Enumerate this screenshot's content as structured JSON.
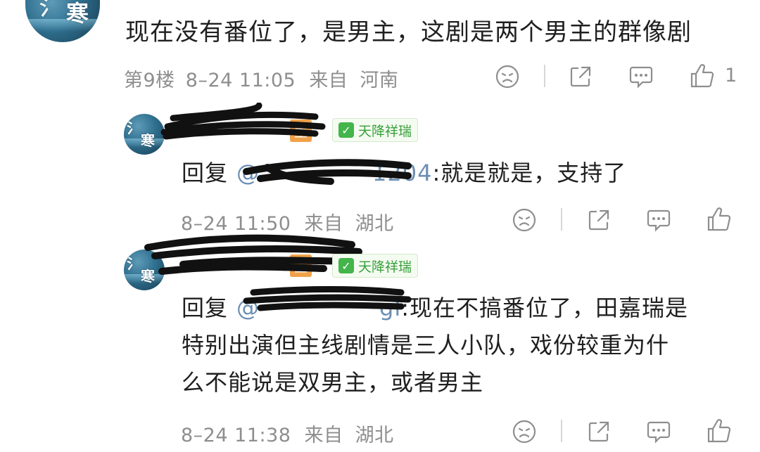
{
  "comment": {
    "text": "现在没有番位了，是男主，这剧是两个男主的群像剧",
    "floor": "第9楼",
    "time": "8–24 11:05",
    "from": "来自",
    "location": "河南",
    "like_count": "1",
    "avatar_glyph": "寒"
  },
  "replies": [
    {
      "avatar_glyph": "寒",
      "badge_orange": "主",
      "badge_green": "天降祥瑞",
      "reply_prefix": "回复",
      "mention": "@",
      "mention_tail": "1204",
      "text": ":就是就是，支持了",
      "time": "8–24 11:50",
      "from": "来自",
      "location": "湖北"
    },
    {
      "avatar_glyph": "寒",
      "badge_orange": "主",
      "badge_green": "天降祥瑞",
      "reply_prefix": "回复",
      "mention": "@",
      "mention_tail": "gl",
      "text_line1": ":现在不搞番位了，田嘉瑞是",
      "text_line2": "特别出演但主线剧情是三人小队，戏份较重为什",
      "text_line3": "么不能说是双男主，或者男主",
      "time": "8–24 11:38",
      "from": "来自",
      "location": "湖北"
    }
  ],
  "icons": [
    "dislike-face-icon",
    "share-icon",
    "comment-icon",
    "like-thumb-icon",
    "check-icon"
  ],
  "colors": {
    "meta_gray": "#8e8e8e",
    "mention_blue": "#6b8fb4",
    "badge_green": "#36a03a",
    "badge_orange": "#f0a24a"
  }
}
